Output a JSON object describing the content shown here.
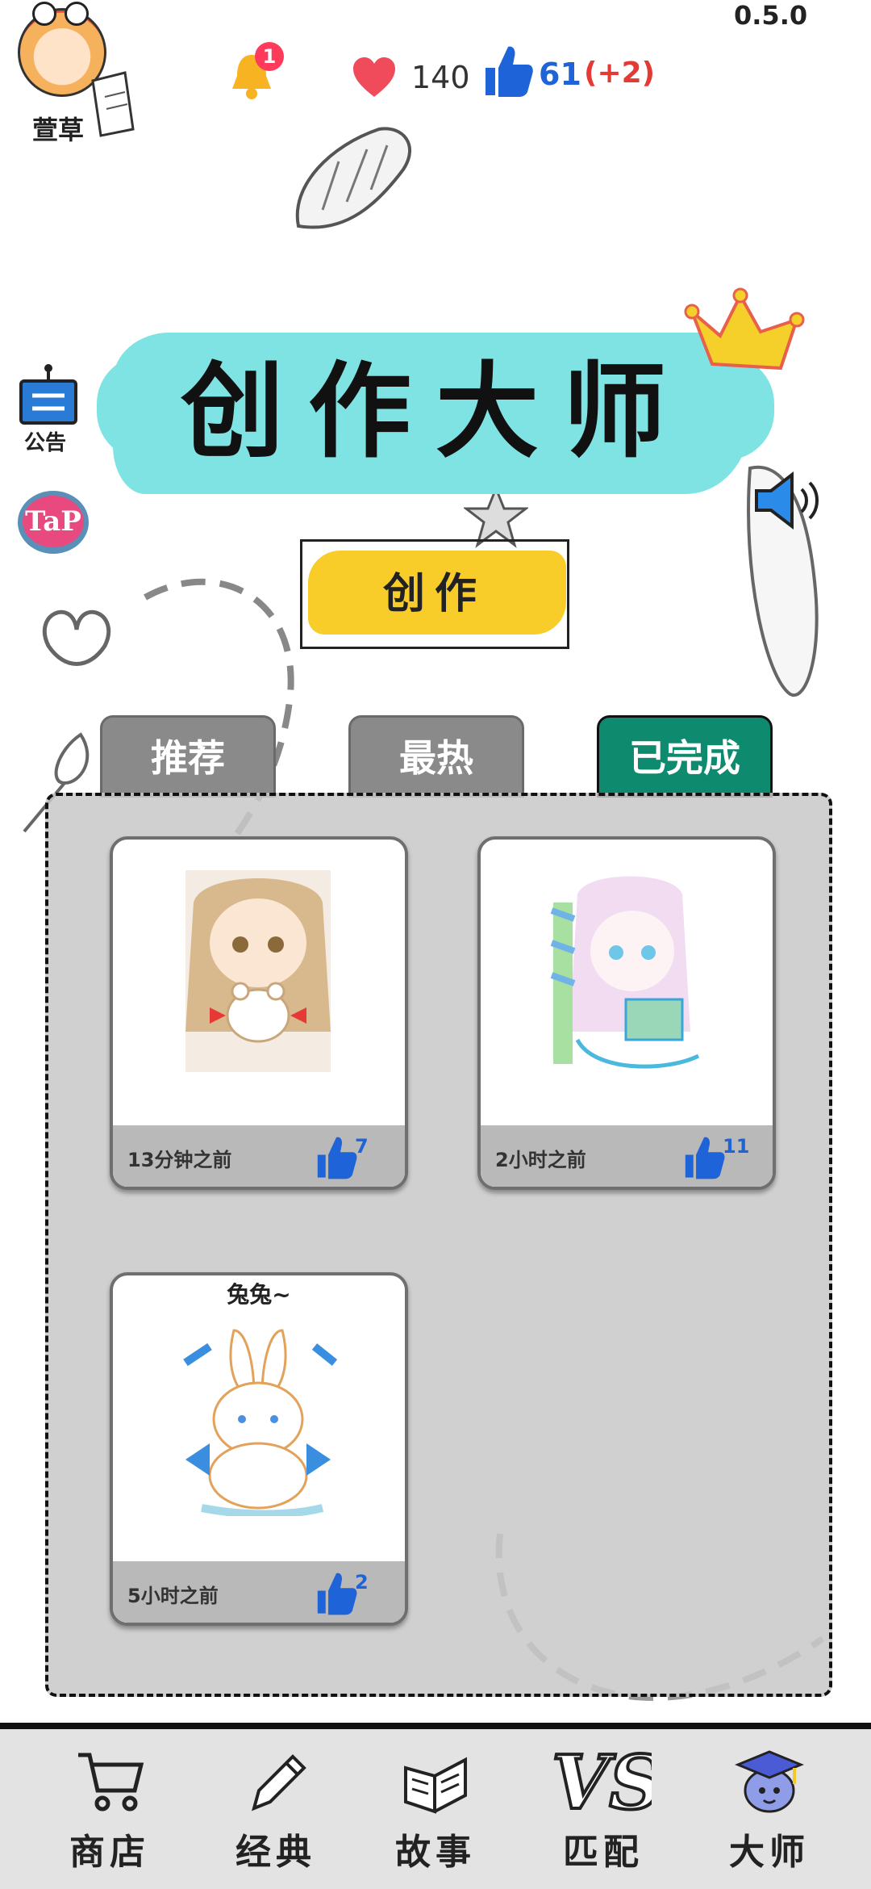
{
  "version": "0.5.0",
  "user": {
    "name": "萱草",
    "avatar_icon": "avatar-icon"
  },
  "stats": {
    "notification_badge": "1",
    "likes": "140",
    "thumbs": "61",
    "thumbs_delta": "(+2)"
  },
  "side": {
    "announcement_label": "公告",
    "tap_label": "TaP"
  },
  "title": "创作大师",
  "create_button": "创作",
  "tabs": [
    {
      "label": "推荐",
      "active": false
    },
    {
      "label": "最热",
      "active": false
    },
    {
      "label": "已完成",
      "active": true
    }
  ],
  "cards": [
    {
      "title": "",
      "time": "13分钟之前",
      "likes": "7"
    },
    {
      "title": "",
      "time": "2小时之前",
      "likes": "11"
    },
    {
      "title": "兔兔~",
      "time": "5小时之前",
      "likes": "2"
    }
  ],
  "nav": [
    {
      "label": "商店",
      "icon": "cart-icon"
    },
    {
      "label": "经典",
      "icon": "pencil-icon"
    },
    {
      "label": "故事",
      "icon": "book-icon"
    },
    {
      "label": "匹配",
      "icon": "vs-icon"
    },
    {
      "label": "大师",
      "icon": "graduate-icon"
    }
  ],
  "colors": {
    "accent_teal": "#0e8a6f",
    "title_highlight": "#7fe3e3",
    "create_yellow": "#f8cd2a",
    "like_blue": "#1e64d8",
    "delta_red": "#e53935"
  }
}
